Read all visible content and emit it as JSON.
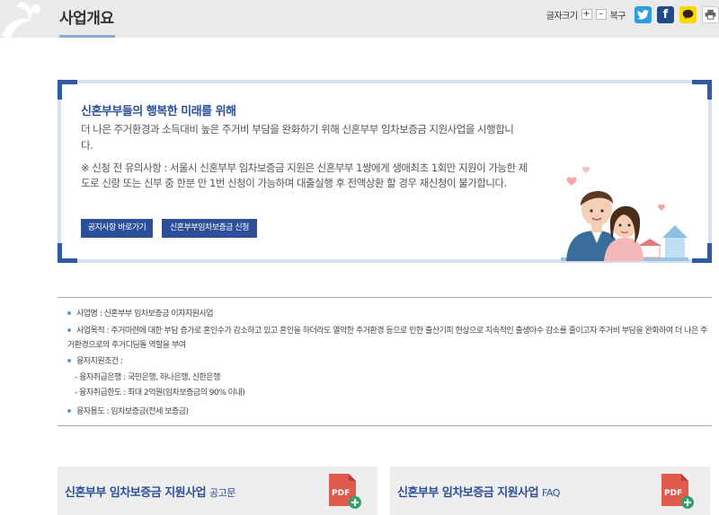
{
  "header": {
    "title": "사업개요",
    "font_size_label": "글자크기",
    "increase": "+",
    "decrease": "–",
    "reset": "복구",
    "facebook_letter": "f"
  },
  "intro": {
    "title": "신혼부부들의 행복한 미래를 위해",
    "description": "더 나은 주거환경과 소득대비 높은 주거비 부담을 완화하기 위해 신혼부부 임차보증금 지원사업을 시행합니다.",
    "note": "※ 신청 전 유의사항 : 서울시 신혼부부 임차보증금 지원은 신혼부부 1쌍에게 생애최초 1회만 지원이 가능한 제도로 신랑 또는 신부 중 한분 만 1번 신청이 가능하며 대출실행 후 전액상환 할 경우 재신청이 불가합니다.",
    "button_notice": "공지사항 바로가기",
    "button_apply": "신혼부부임차보증금 신청"
  },
  "info": {
    "name": "사업명 : 신혼부부 임차보증금 이자지원사업",
    "purpose": "사업목적 : 주거마련에 대한 부담 증가로 혼인수가 감소하고 있고 혼인을 하더라도 열악한 주거환경 등으로 인한 출산기피 현상으로 지속적인 출생아수 감소를 줄이고자 주거비 부담을 완화하여 더 나은 주거환경으로의 주거디딤돌 역할을 부여",
    "conditions_label": "융자지원조건 :",
    "banks": "- 융자취급은행 : 국민은행, 하나은행, 신한은행",
    "limit": "- 융자취급한도 : 최대 2억원(임차보증금의 90% 이내)",
    "usage": "융자용도 : 임차보증금(전세 보증금)"
  },
  "cards": [
    {
      "title": "신혼부부 임차보증금 지원사업",
      "suffix": "공고문"
    },
    {
      "title": "신혼부부 임차보증금 지원사업",
      "suffix": "FAQ"
    }
  ],
  "colors": {
    "accent": "#2d4f9a",
    "frame": "#d5dff0",
    "bullet": "#5b9bd5",
    "header_bg": "#eaeaea",
    "pdf_red": "#e05a4e",
    "pdf_green": "#2fa36b"
  }
}
